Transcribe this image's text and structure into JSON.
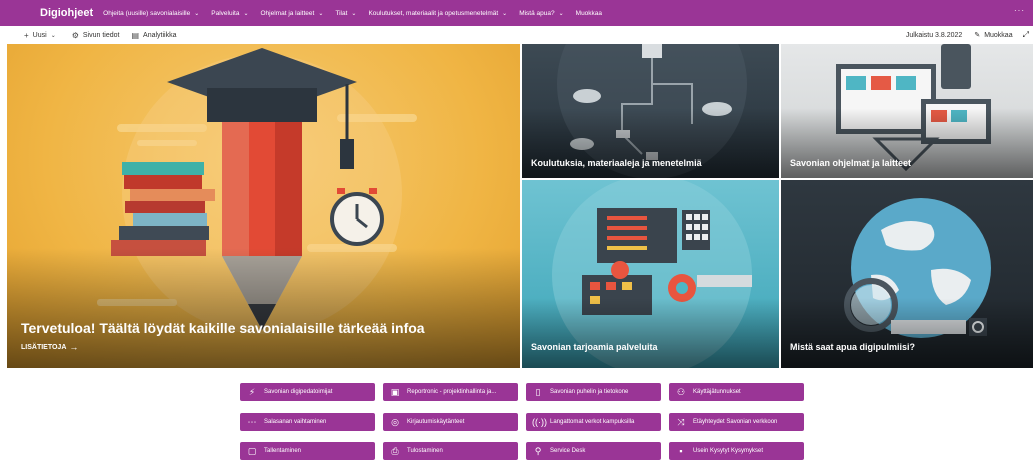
{
  "nav": {
    "brand": "Digiohjeet",
    "items": [
      {
        "label": "Ohjeita (uusille) savonialaisille",
        "has_dropdown": true
      },
      {
        "label": "Palveluita",
        "has_dropdown": true
      },
      {
        "label": "Ohjelmat ja laitteet",
        "has_dropdown": true
      },
      {
        "label": "Tilat",
        "has_dropdown": true
      },
      {
        "label": "Koulutukset, materiaalit ja opetusmenetelmät",
        "has_dropdown": true
      },
      {
        "label": "Mistä apua?",
        "has_dropdown": true
      },
      {
        "label": "Muokkaa",
        "has_dropdown": false
      }
    ],
    "more": "···"
  },
  "commandbar": {
    "new_label": "Uusi",
    "page_details_label": "Sivun tiedot",
    "analytics_label": "Analytiikka",
    "published": "Julkaistu 3.8.2022",
    "edit_label": "Muokkaa"
  },
  "hero": {
    "main_title": "Tervetuloa! Täältä löydät kaikille savonialaisille tärkeää infoa",
    "main_link": "LISÄTIETOJA",
    "tiles": [
      {
        "title": "Koulutuksia, materiaaleja ja menetelmiä"
      },
      {
        "title": "Savonian ohjelmat ja laitteet"
      },
      {
        "title": "Savonian tarjoamia palveluita"
      },
      {
        "title": "Mistä saat apua digipulmiisi?"
      }
    ]
  },
  "quicklinks": [
    {
      "label": "Savonian digipedatoimijat",
      "icon": "lightning-icon"
    },
    {
      "label": "Reportronic - projektinhallinta ja...",
      "icon": "report-icon"
    },
    {
      "label": "Savonian puhelin ja tietokone",
      "icon": "phone-icon"
    },
    {
      "label": "Käyttäjätunnukset",
      "icon": "users-icon"
    },
    {
      "label": "Salasanan vaihtaminen",
      "icon": "password-icon"
    },
    {
      "label": "Kirjautumiskäytänteet",
      "icon": "login-icon"
    },
    {
      "label": "Langattomat verkot kampuksilla",
      "icon": "wifi-icon"
    },
    {
      "label": "Etäyhteydet Savonian verkkoon",
      "icon": "remote-icon"
    },
    {
      "label": "Tallentaminen",
      "icon": "save-icon"
    },
    {
      "label": "Tulostaminen",
      "icon": "printer-icon"
    },
    {
      "label": "Service Desk",
      "icon": "support-icon"
    },
    {
      "label": "Usein Kysytyt Kysymykset",
      "icon": "faq-icon"
    }
  ],
  "colors": {
    "brand": "#9a3596"
  }
}
